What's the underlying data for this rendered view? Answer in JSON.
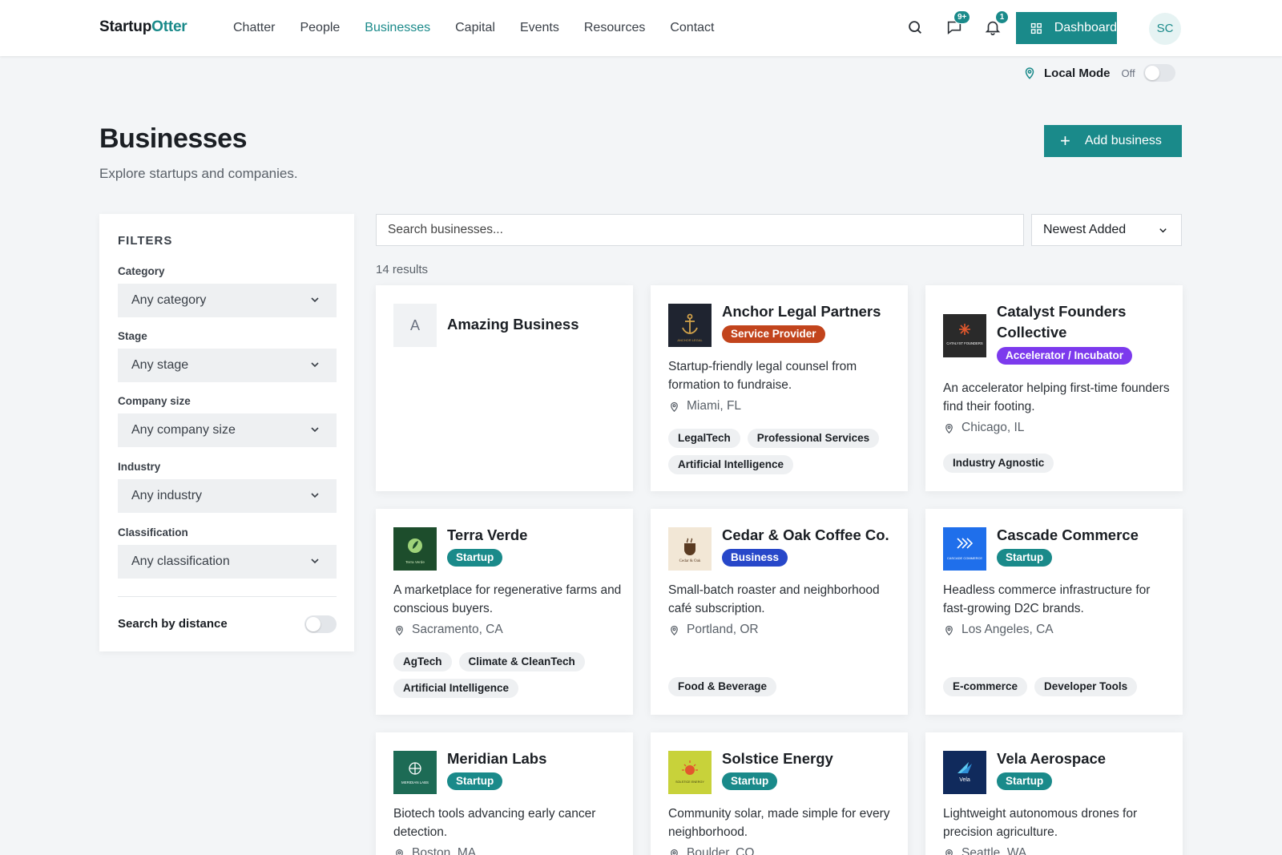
{
  "header": {
    "logo_part1": "Startup",
    "logo_part2": "Otter",
    "nav": [
      "Chatter",
      "People",
      "Businesses",
      "Capital",
      "Events",
      "Resources",
      "Contact"
    ],
    "active_nav": "Businesses",
    "messages_badge": "9+",
    "notifications_badge": "1",
    "dashboard_label": "Dashboard",
    "avatar_initials": "SC"
  },
  "local_mode": {
    "label": "Local Mode",
    "state": "Off"
  },
  "page": {
    "title": "Businesses",
    "subtitle": "Explore startups and companies.",
    "add_label": "Add business"
  },
  "filters": {
    "heading": "FILTERS",
    "fields": [
      {
        "label": "Category",
        "value": "Any category"
      },
      {
        "label": "Stage",
        "value": "Any stage"
      },
      {
        "label": "Company size",
        "value": "Any company size"
      },
      {
        "label": "Industry",
        "value": "Any industry"
      },
      {
        "label": "Classification",
        "value": "Any classification"
      }
    ],
    "distance_label": "Search by distance"
  },
  "search": {
    "placeholder": "Search businesses..."
  },
  "sort": {
    "value": "Newest Added"
  },
  "results_text": "14 results",
  "colors": {
    "accent": "#1a8a8a",
    "service_provider": "#c2441c",
    "accelerator": "#7c3aed",
    "business": "#2747c9",
    "startup": "#1a8a8a"
  },
  "cards": [
    {
      "name": "Amazing Business",
      "logo_letter": "A",
      "tag": "",
      "desc": "",
      "location": "",
      "chips": []
    },
    {
      "name": "Anchor Legal Partners",
      "tag": "Service Provider",
      "logo_text": "ANCHOR LEGAL",
      "desc": "Startup-friendly legal counsel from formation to fundraise.",
      "location": "Miami, FL",
      "chips": [
        "LegalTech",
        "Professional Services",
        "Artificial Intelligence"
      ]
    },
    {
      "name": "Catalyst Founders Collective",
      "tag": "Accelerator / Incubator",
      "logo_text": "CATALYST FOUNDERS",
      "desc": "An accelerator helping first-time founders find their footing.",
      "location": "Chicago, IL",
      "chips": [
        "Industry Agnostic"
      ]
    },
    {
      "name": "Terra Verde",
      "tag": "Startup",
      "logo_text": "Terra Verde",
      "desc": "A marketplace for regenerative farms and conscious buyers.",
      "location": "Sacramento, CA",
      "chips": [
        "AgTech",
        "Climate & CleanTech",
        "Artificial Intelligence"
      ]
    },
    {
      "name": "Cedar & Oak Coffee Co.",
      "tag": "Business",
      "logo_text": "Cedar & Oak",
      "desc": "Small-batch roaster and neighborhood café subscription.",
      "location": "Portland, OR",
      "chips": [
        "Food & Beverage"
      ]
    },
    {
      "name": "Cascade Commerce",
      "tag": "Startup",
      "logo_text": "CASCADE COMMERCE",
      "desc": "Headless commerce infrastructure for fast-growing D2C brands.",
      "location": "Los Angeles, CA",
      "chips": [
        "E-commerce",
        "Developer Tools"
      ]
    },
    {
      "name": "Meridian Labs",
      "tag": "Startup",
      "logo_text": "MERIDIAN LABS",
      "desc": "Biotech tools advancing early cancer detection.",
      "location": "Boston, MA",
      "chips": []
    },
    {
      "name": "Solstice Energy",
      "tag": "Startup",
      "logo_text": "SOLSTICE ENERGY",
      "desc": "Community solar, made simple for every neighborhood.",
      "location": "Boulder, CO",
      "chips": []
    },
    {
      "name": "Vela Aerospace",
      "tag": "Startup",
      "logo_text": "Vela",
      "desc": "Lightweight autonomous drones for precision agriculture.",
      "location": "Seattle, WA",
      "chips": []
    }
  ]
}
